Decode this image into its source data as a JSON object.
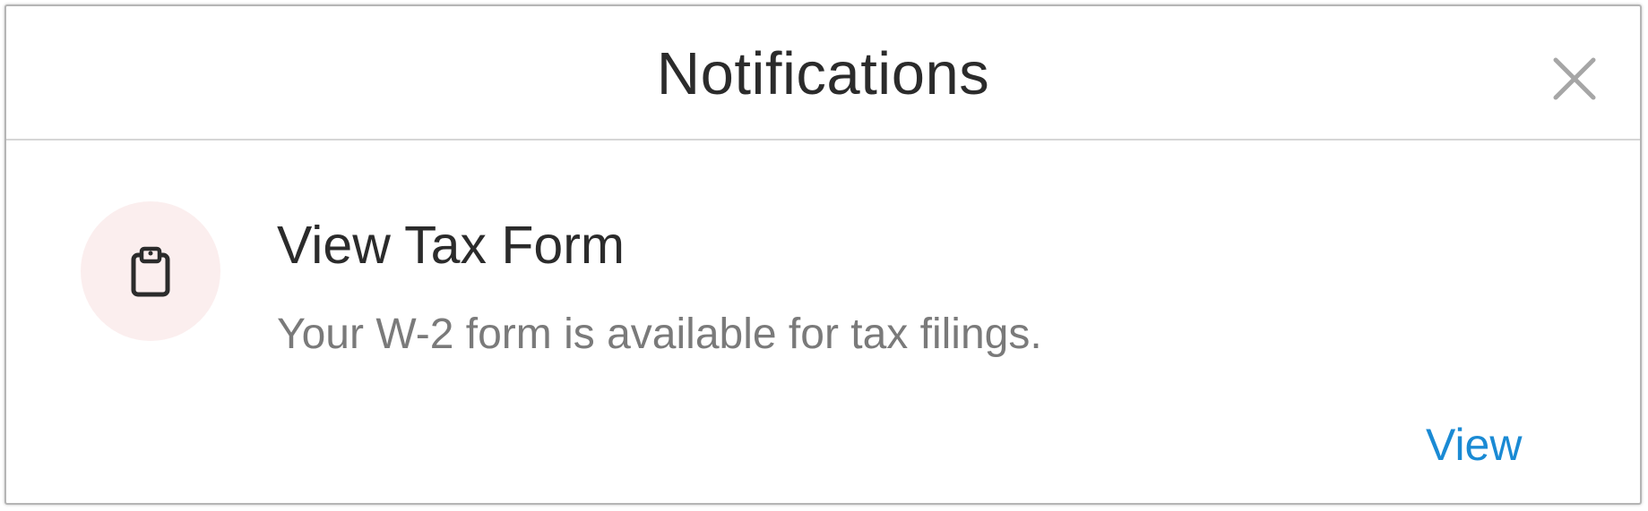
{
  "header": {
    "title": "Notifications"
  },
  "notification": {
    "icon": "clipboard-icon",
    "title": "View Tax Form",
    "description": "Your W-2 form is available for tax filings.",
    "action_label": "View"
  },
  "colors": {
    "accent": "#1a8ad4",
    "icon_bg": "#fbeeee",
    "title_text": "#2b2b2b",
    "secondary_text": "#7a7a7a"
  }
}
